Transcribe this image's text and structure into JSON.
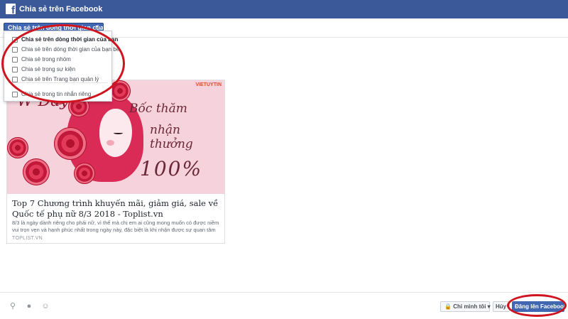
{
  "window": {
    "title": "Chia sẻ trên Facebook"
  },
  "audience": {
    "selected_label": "Chia sẻ trên dòng thời gian của bạn"
  },
  "share_menu": {
    "items": [
      {
        "label": "Chia sẻ trên dòng thời gian của bạn",
        "icon": "pencil-icon"
      },
      {
        "label": "Chia sẻ trên dòng thời gian của bạn bè",
        "icon": "friends-icon"
      },
      {
        "label": "Chia sẻ trong nhóm",
        "icon": "group-icon"
      },
      {
        "label": "Chia sẻ trong sự kiện",
        "icon": "calendar-icon"
      },
      {
        "label": "Chia sẻ trên Trang bạn quản lý",
        "icon": "flag-icon"
      },
      {
        "label": "Chia sẻ trong tin nhắn riêng",
        "icon": "message-icon"
      }
    ]
  },
  "link_preview": {
    "image_logo": "VIETUYTIN",
    "image_text_1": "Bốc thăm",
    "image_text_2": "nhận thưởng",
    "image_text_3": "100%",
    "image_text_4": "W Day",
    "title": "Top 7 Chương trình khuyến mãi, giảm giá, sale về Quốc tế phụ nữ 8/3 2018 - Toplist.vn",
    "description": "8/3 là ngày dành riêng cho phái nữ, vì thế mà chị em ai cũng mong muốn có được niềm vui trọn vẹn và hạnh phúc nhất trong ngày này, đặc biệt là khi nhận được sự quan tâm từ chính...",
    "source": "TOPLIST.VN"
  },
  "footer": {
    "privacy_label": "Chỉ mình tôi",
    "cancel_label": "Hủy",
    "post_label": "Đăng lên Facebook"
  },
  "colors": {
    "brand": "#3b5998",
    "button": "#4267b2",
    "highlight": "#d0141e"
  }
}
